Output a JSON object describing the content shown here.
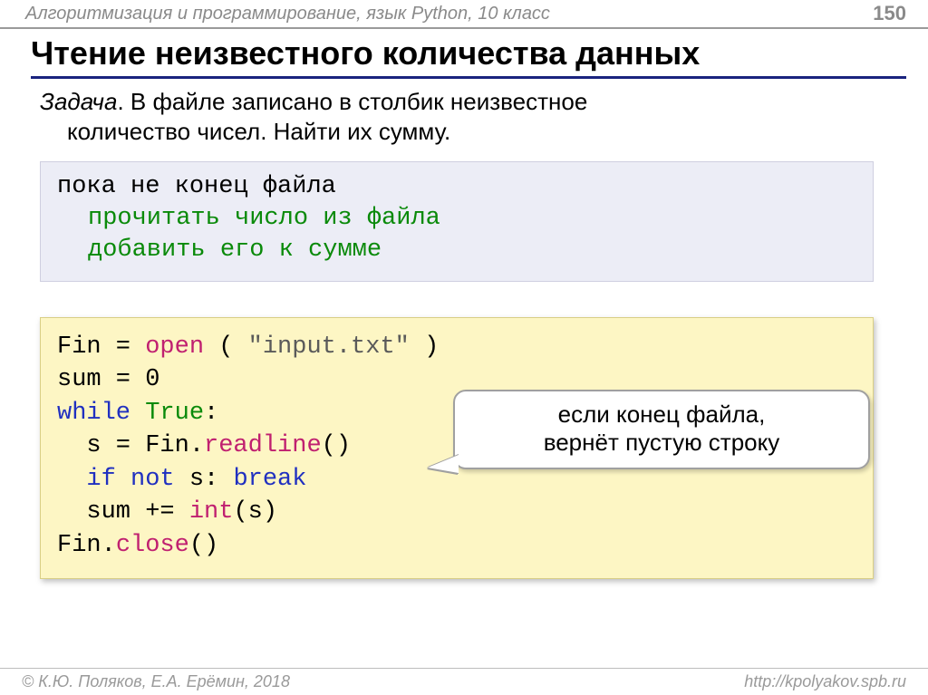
{
  "header": {
    "course": "Алгоритмизация и программирование, язык Python, 10 класс",
    "page": "150"
  },
  "title": "Чтение неизвестного количества данных",
  "task": {
    "label": "Задача",
    "text_line1": ". В файле записано в столбик неизвестное",
    "text_line2": "количество чисел. Найти их сумму."
  },
  "pseudocode": {
    "l1": "пока не конец файла",
    "l2": "прочитать число из файла",
    "l3": "добавить его к сумме"
  },
  "code": {
    "t_fin": "Fin",
    "t_eq": " = ",
    "t_open": "open",
    "t_open_args": " ( \"input.txt\" )",
    "t_str": "\"input.txt\"",
    "t_lpar_sp": " ( ",
    "t_rpar_sp": " )",
    "t_sum": "sum",
    "t_zero": " = 0",
    "t_while": "while",
    "t_sp": " ",
    "t_true": "True",
    "t_colon": ":",
    "t_indent": "  ",
    "t_s": "s",
    "t_eq2": " = Fin.",
    "t_readline": "readline",
    "t_paren": "()",
    "t_if": "if",
    "t_not": "not",
    "t_s2": " s: ",
    "t_break": "break",
    "t_sumpe": "sum += ",
    "t_int": "int",
    "t_ints": "(s)",
    "t_fin_dot": "Fin.",
    "t_close": "close",
    "t_close_p": "()"
  },
  "callout": {
    "l1": "если конец файла,",
    "l2": "вернёт пустую строку"
  },
  "footer": {
    "left": "© К.Ю. Поляков, Е.А. Ерёмин, 2018",
    "right": "http://kpolyakov.spb.ru"
  }
}
